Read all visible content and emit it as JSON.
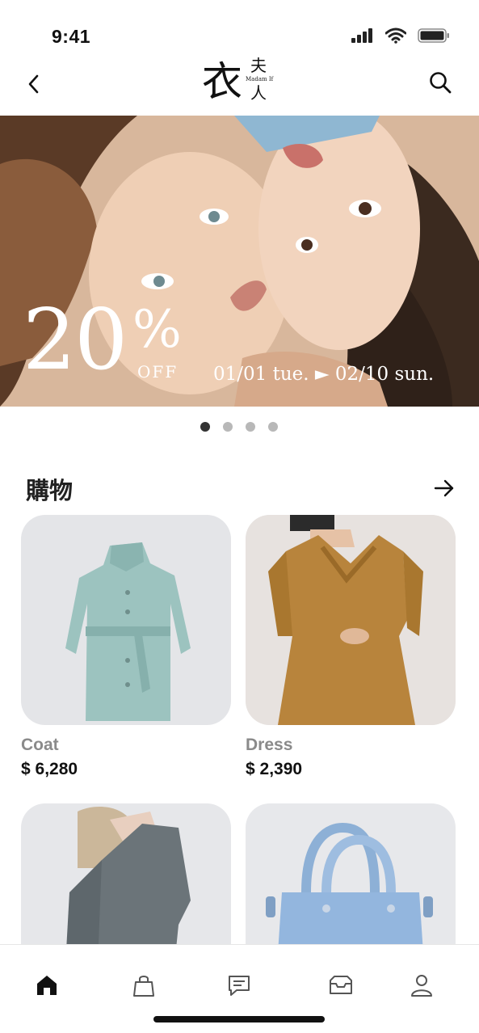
{
  "status_bar": {
    "time": "9:41"
  },
  "header": {
    "logo_main": "衣",
    "logo_top": "夫",
    "logo_bottom": "人",
    "logo_en": "Madam If"
  },
  "banner": {
    "discount_number": "20",
    "discount_sign": "%",
    "discount_off": "OFF",
    "date_range": "01/01 tue. ► 02/10 sun.",
    "page_count": 4,
    "active_page": 1
  },
  "section": {
    "title": "購物"
  },
  "products": [
    {
      "name": "Coat",
      "price": "$ 6,280"
    },
    {
      "name": "Dress",
      "price": "$ 2,390"
    }
  ],
  "tab_bar": {
    "tabs": [
      "home-icon",
      "shopping-bag-icon",
      "chat-icon",
      "inbox-icon",
      "profile-icon"
    ],
    "active": "home-icon"
  }
}
